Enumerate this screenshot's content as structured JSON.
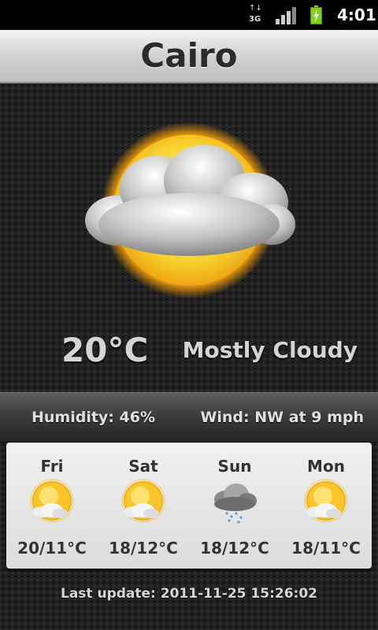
{
  "status_bar": {
    "network_label": "3G",
    "network_arrows": "↑↓",
    "time": "4:01",
    "icons": [
      "network-3g-icon",
      "signal-strength-icon",
      "battery-charging-icon"
    ]
  },
  "header": {
    "city": "Cairo"
  },
  "current": {
    "temperature": "20°C",
    "condition": "Mostly Cloudy",
    "icon": "mostly-cloudy-icon"
  },
  "details": {
    "humidity": "Humidity: 46%",
    "wind": "Wind: NW at 9 mph"
  },
  "forecast": [
    {
      "day": "Fri",
      "temps": "20/11°C",
      "icon": "partly-sunny-icon"
    },
    {
      "day": "Sat",
      "temps": "18/12°C",
      "icon": "partly-sunny-icon"
    },
    {
      "day": "Sun",
      "temps": "18/12°C",
      "icon": "rain-cloud-icon"
    },
    {
      "day": "Mon",
      "temps": "18/11°C",
      "icon": "partly-sunny-icon"
    }
  ],
  "footer": {
    "last_update": "Last update: 2011-11-25 15:26:02"
  },
  "colors": {
    "sun": "#f7c21a",
    "cloud": "#d8d8d8",
    "battery": "#7fd01f"
  }
}
